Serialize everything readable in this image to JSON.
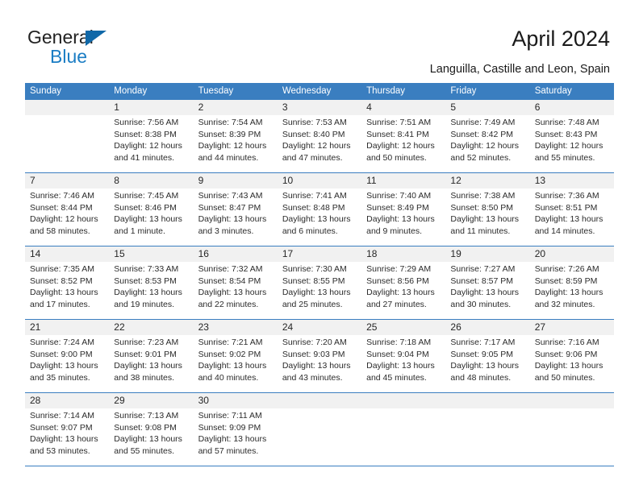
{
  "brand": {
    "line1": "General",
    "line2": "Blue",
    "accent": "#1b7dc4",
    "triangle_color": "#1068a8"
  },
  "header": {
    "title": "April 2024",
    "location": "Languilla, Castille and Leon, Spain"
  },
  "calendar": {
    "header_color": "#3a7ec0",
    "day_band_color": "#f1f1f1",
    "weekday_headers": [
      "Sunday",
      "Monday",
      "Tuesday",
      "Wednesday",
      "Thursday",
      "Friday",
      "Saturday"
    ],
    "weeks": [
      {
        "days": [
          {
            "number": "",
            "lines": []
          },
          {
            "number": "1",
            "lines": [
              "Sunrise: 7:56 AM",
              "Sunset: 8:38 PM",
              "Daylight: 12 hours",
              "and 41 minutes."
            ]
          },
          {
            "number": "2",
            "lines": [
              "Sunrise: 7:54 AM",
              "Sunset: 8:39 PM",
              "Daylight: 12 hours",
              "and 44 minutes."
            ]
          },
          {
            "number": "3",
            "lines": [
              "Sunrise: 7:53 AM",
              "Sunset: 8:40 PM",
              "Daylight: 12 hours",
              "and 47 minutes."
            ]
          },
          {
            "number": "4",
            "lines": [
              "Sunrise: 7:51 AM",
              "Sunset: 8:41 PM",
              "Daylight: 12 hours",
              "and 50 minutes."
            ]
          },
          {
            "number": "5",
            "lines": [
              "Sunrise: 7:49 AM",
              "Sunset: 8:42 PM",
              "Daylight: 12 hours",
              "and 52 minutes."
            ]
          },
          {
            "number": "6",
            "lines": [
              "Sunrise: 7:48 AM",
              "Sunset: 8:43 PM",
              "Daylight: 12 hours",
              "and 55 minutes."
            ]
          }
        ]
      },
      {
        "days": [
          {
            "number": "7",
            "lines": [
              "Sunrise: 7:46 AM",
              "Sunset: 8:44 PM",
              "Daylight: 12 hours",
              "and 58 minutes."
            ]
          },
          {
            "number": "8",
            "lines": [
              "Sunrise: 7:45 AM",
              "Sunset: 8:46 PM",
              "Daylight: 13 hours",
              "and 1 minute."
            ]
          },
          {
            "number": "9",
            "lines": [
              "Sunrise: 7:43 AM",
              "Sunset: 8:47 PM",
              "Daylight: 13 hours",
              "and 3 minutes."
            ]
          },
          {
            "number": "10",
            "lines": [
              "Sunrise: 7:41 AM",
              "Sunset: 8:48 PM",
              "Daylight: 13 hours",
              "and 6 minutes."
            ]
          },
          {
            "number": "11",
            "lines": [
              "Sunrise: 7:40 AM",
              "Sunset: 8:49 PM",
              "Daylight: 13 hours",
              "and 9 minutes."
            ]
          },
          {
            "number": "12",
            "lines": [
              "Sunrise: 7:38 AM",
              "Sunset: 8:50 PM",
              "Daylight: 13 hours",
              "and 11 minutes."
            ]
          },
          {
            "number": "13",
            "lines": [
              "Sunrise: 7:36 AM",
              "Sunset: 8:51 PM",
              "Daylight: 13 hours",
              "and 14 minutes."
            ]
          }
        ]
      },
      {
        "days": [
          {
            "number": "14",
            "lines": [
              "Sunrise: 7:35 AM",
              "Sunset: 8:52 PM",
              "Daylight: 13 hours",
              "and 17 minutes."
            ]
          },
          {
            "number": "15",
            "lines": [
              "Sunrise: 7:33 AM",
              "Sunset: 8:53 PM",
              "Daylight: 13 hours",
              "and 19 minutes."
            ]
          },
          {
            "number": "16",
            "lines": [
              "Sunrise: 7:32 AM",
              "Sunset: 8:54 PM",
              "Daylight: 13 hours",
              "and 22 minutes."
            ]
          },
          {
            "number": "17",
            "lines": [
              "Sunrise: 7:30 AM",
              "Sunset: 8:55 PM",
              "Daylight: 13 hours",
              "and 25 minutes."
            ]
          },
          {
            "number": "18",
            "lines": [
              "Sunrise: 7:29 AM",
              "Sunset: 8:56 PM",
              "Daylight: 13 hours",
              "and 27 minutes."
            ]
          },
          {
            "number": "19",
            "lines": [
              "Sunrise: 7:27 AM",
              "Sunset: 8:57 PM",
              "Daylight: 13 hours",
              "and 30 minutes."
            ]
          },
          {
            "number": "20",
            "lines": [
              "Sunrise: 7:26 AM",
              "Sunset: 8:59 PM",
              "Daylight: 13 hours",
              "and 32 minutes."
            ]
          }
        ]
      },
      {
        "days": [
          {
            "number": "21",
            "lines": [
              "Sunrise: 7:24 AM",
              "Sunset: 9:00 PM",
              "Daylight: 13 hours",
              "and 35 minutes."
            ]
          },
          {
            "number": "22",
            "lines": [
              "Sunrise: 7:23 AM",
              "Sunset: 9:01 PM",
              "Daylight: 13 hours",
              "and 38 minutes."
            ]
          },
          {
            "number": "23",
            "lines": [
              "Sunrise: 7:21 AM",
              "Sunset: 9:02 PM",
              "Daylight: 13 hours",
              "and 40 minutes."
            ]
          },
          {
            "number": "24",
            "lines": [
              "Sunrise: 7:20 AM",
              "Sunset: 9:03 PM",
              "Daylight: 13 hours",
              "and 43 minutes."
            ]
          },
          {
            "number": "25",
            "lines": [
              "Sunrise: 7:18 AM",
              "Sunset: 9:04 PM",
              "Daylight: 13 hours",
              "and 45 minutes."
            ]
          },
          {
            "number": "26",
            "lines": [
              "Sunrise: 7:17 AM",
              "Sunset: 9:05 PM",
              "Daylight: 13 hours",
              "and 48 minutes."
            ]
          },
          {
            "number": "27",
            "lines": [
              "Sunrise: 7:16 AM",
              "Sunset: 9:06 PM",
              "Daylight: 13 hours",
              "and 50 minutes."
            ]
          }
        ]
      },
      {
        "days": [
          {
            "number": "28",
            "lines": [
              "Sunrise: 7:14 AM",
              "Sunset: 9:07 PM",
              "Daylight: 13 hours",
              "and 53 minutes."
            ]
          },
          {
            "number": "29",
            "lines": [
              "Sunrise: 7:13 AM",
              "Sunset: 9:08 PM",
              "Daylight: 13 hours",
              "and 55 minutes."
            ]
          },
          {
            "number": "30",
            "lines": [
              "Sunrise: 7:11 AM",
              "Sunset: 9:09 PM",
              "Daylight: 13 hours",
              "and 57 minutes."
            ]
          },
          {
            "number": "",
            "lines": []
          },
          {
            "number": "",
            "lines": []
          },
          {
            "number": "",
            "lines": []
          },
          {
            "number": "",
            "lines": []
          }
        ]
      }
    ]
  }
}
